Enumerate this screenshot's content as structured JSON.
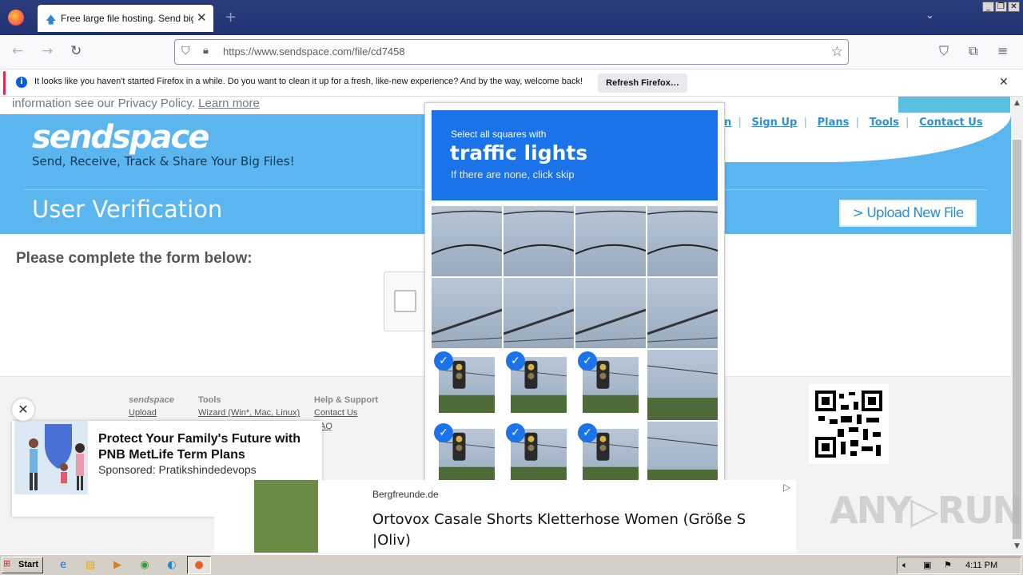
{
  "browser": {
    "tab_title": "Free large file hosting. Send big file",
    "url": "https://www.sendspace.com/file/cd7458",
    "notification_text": "It looks like you haven't started Firefox in a while. Do you want to clean it up for a fresh, like-new experience? And by the way, welcome back!",
    "notification_button": "Refresh Firefox…"
  },
  "page": {
    "privacy_text": "information see our Privacy Policy.",
    "learn_more": "Learn more",
    "logo": "sendspace",
    "tagline": "Send, Receive, Track & Share Your Big Files!",
    "title": "User Verification",
    "upload_button": "> Upload New File",
    "nav": [
      "n",
      "Sign Up",
      "Plans",
      "Tools",
      "Contact Us"
    ],
    "form_heading": "Please complete the form below:",
    "footer": {
      "col1_head": "sendspace",
      "col1_links": [
        "Upload"
      ],
      "col2_head": "Tools",
      "col2_links": [
        "Wizard (Win*, Mac, Linux)"
      ],
      "col3_head": "Help & Support",
      "col3_links": [
        "Contact Us",
        "AQ"
      ]
    }
  },
  "captcha": {
    "instruction_sub": "Select all squares with",
    "instruction_main": "traffic lights",
    "instruction_skip": "If there are none, click skip",
    "tiles_selected": [
      false,
      false,
      false,
      false,
      false,
      false,
      false,
      false,
      true,
      true,
      true,
      false,
      true,
      true,
      true,
      false
    ]
  },
  "ads": {
    "ad1_title": "Protect Your Family's Future with PNB MetLife Term Plans",
    "ad1_sponsor": "Sponsored: Pratikshindedevops",
    "ad2_source": "Bergfreunde.de",
    "ad2_title": "Ortovox Casale Shorts Kletterhose Women (Größe S |Oliv)"
  },
  "watermark": "ANY▷RUN",
  "taskbar": {
    "start": "Start",
    "clock": "4:11 PM"
  }
}
